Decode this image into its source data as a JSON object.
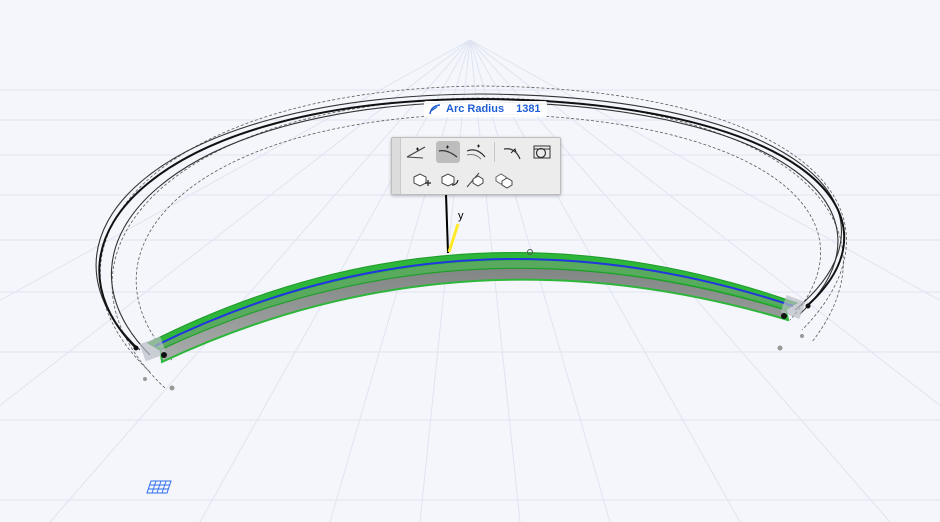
{
  "tracker": {
    "label": "Arc Radius",
    "value": "1381",
    "icon": "arc-radius-icon"
  },
  "axis": {
    "y_label": "y"
  },
  "palette": {
    "active_tool": "tangent-arc-icon",
    "row1": [
      "straight-edge-icon",
      "tangent-arc-icon",
      "arc-edge-icon",
      "arc-offset-icon",
      "curve-options-icon"
    ],
    "row2": [
      "move-node-icon",
      "drag-offset-icon",
      "offset-edge-icon",
      "offset-all-icon"
    ]
  },
  "colors": {
    "beam_top": "#2db63a",
    "beam_side": "#8a8e8c",
    "reference_line": "#2336e0",
    "tracker_text": "#1f5fd6",
    "grid_line": "#dfe4f1"
  }
}
